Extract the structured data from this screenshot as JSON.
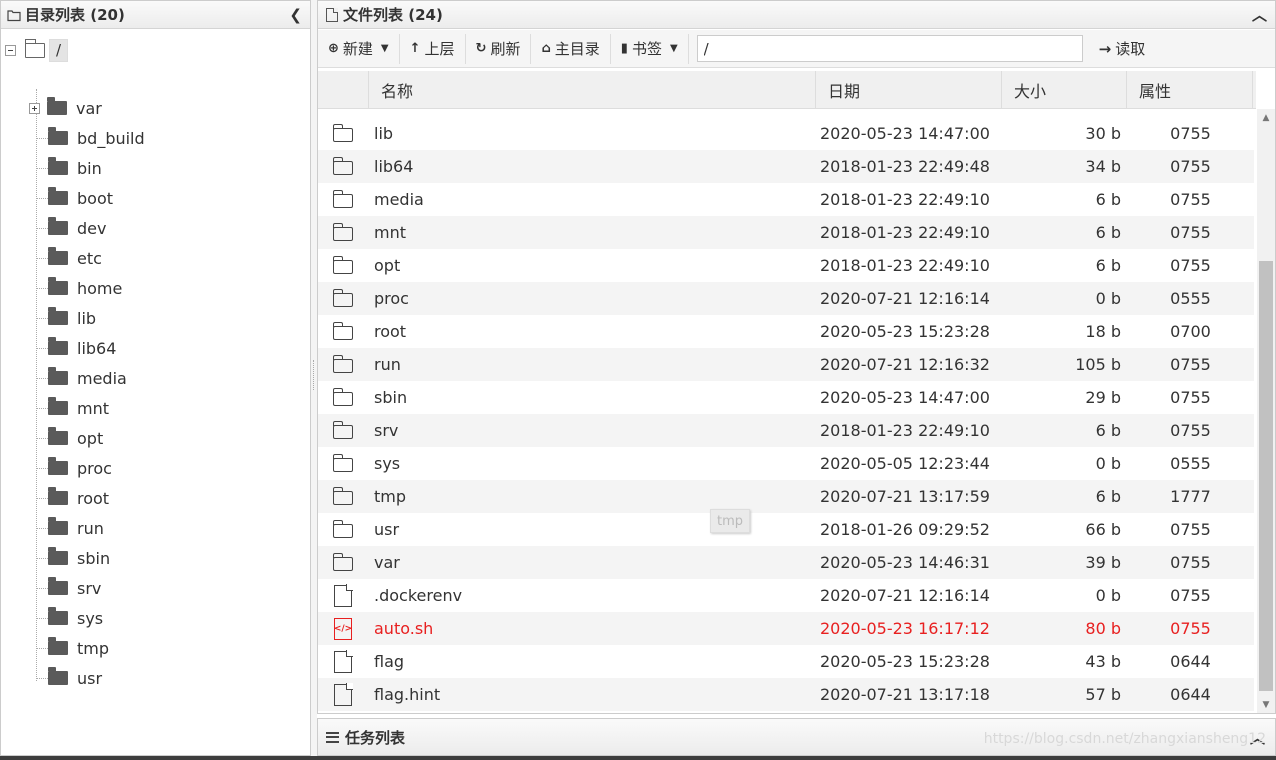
{
  "left_panel": {
    "title": "目录列表 (20)",
    "root_label": "/",
    "items": [
      {
        "label": "var",
        "expandable": true
      },
      {
        "label": "bd_build"
      },
      {
        "label": "bin"
      },
      {
        "label": "boot"
      },
      {
        "label": "dev"
      },
      {
        "label": "etc"
      },
      {
        "label": "home"
      },
      {
        "label": "lib"
      },
      {
        "label": "lib64"
      },
      {
        "label": "media"
      },
      {
        "label": "mnt"
      },
      {
        "label": "opt"
      },
      {
        "label": "proc"
      },
      {
        "label": "root"
      },
      {
        "label": "run"
      },
      {
        "label": "sbin"
      },
      {
        "label": "srv"
      },
      {
        "label": "sys"
      },
      {
        "label": "tmp"
      },
      {
        "label": "usr"
      }
    ]
  },
  "right_panel": {
    "title": "文件列表 (24)",
    "toolbar": {
      "new_label": "新建",
      "up_label": "上层",
      "refresh_label": "刷新",
      "home_label": "主目录",
      "bookmark_label": "书签",
      "path_value": "/",
      "read_label": "读取"
    },
    "columns": [
      "名称",
      "日期",
      "大小",
      "属性"
    ],
    "files": [
      {
        "name": "lib",
        "date": "2020-05-23 14:47:00",
        "size": "30 b",
        "attr": "0755",
        "type": "folder"
      },
      {
        "name": "lib64",
        "date": "2018-01-23 22:49:48",
        "size": "34 b",
        "attr": "0755",
        "type": "folder"
      },
      {
        "name": "media",
        "date": "2018-01-23 22:49:10",
        "size": "6 b",
        "attr": "0755",
        "type": "folder"
      },
      {
        "name": "mnt",
        "date": "2018-01-23 22:49:10",
        "size": "6 b",
        "attr": "0755",
        "type": "folder"
      },
      {
        "name": "opt",
        "date": "2018-01-23 22:49:10",
        "size": "6 b",
        "attr": "0755",
        "type": "folder"
      },
      {
        "name": "proc",
        "date": "2020-07-21 12:16:14",
        "size": "0 b",
        "attr": "0555",
        "type": "folder"
      },
      {
        "name": "root",
        "date": "2020-05-23 15:23:28",
        "size": "18 b",
        "attr": "0700",
        "type": "folder"
      },
      {
        "name": "run",
        "date": "2020-07-21 12:16:32",
        "size": "105 b",
        "attr": "0755",
        "type": "folder"
      },
      {
        "name": "sbin",
        "date": "2020-05-23 14:47:00",
        "size": "29 b",
        "attr": "0755",
        "type": "folder"
      },
      {
        "name": "srv",
        "date": "2018-01-23 22:49:10",
        "size": "6 b",
        "attr": "0755",
        "type": "folder"
      },
      {
        "name": "sys",
        "date": "2020-05-05 12:23:44",
        "size": "0 b",
        "attr": "0555",
        "type": "folder"
      },
      {
        "name": "tmp",
        "date": "2020-07-21 13:17:59",
        "size": "6 b",
        "attr": "1777",
        "type": "folder"
      },
      {
        "name": "usr",
        "date": "2018-01-26 09:29:52",
        "size": "66 b",
        "attr": "0755",
        "type": "folder"
      },
      {
        "name": "var",
        "date": "2020-05-23 14:46:31",
        "size": "39 b",
        "attr": "0755",
        "type": "folder"
      },
      {
        "name": ".dockerenv",
        "date": "2020-07-21 12:16:14",
        "size": "0 b",
        "attr": "0755",
        "type": "file"
      },
      {
        "name": "auto.sh",
        "date": "2020-05-23 16:17:12",
        "size": "80 b",
        "attr": "0755",
        "type": "script",
        "highlight": true
      },
      {
        "name": "flag",
        "date": "2020-05-23 15:23:28",
        "size": "43 b",
        "attr": "0644",
        "type": "file"
      },
      {
        "name": "flag.hint",
        "date": "2020-07-21 13:17:18",
        "size": "57 b",
        "attr": "0644",
        "type": "file"
      }
    ],
    "tooltip": "tmp"
  },
  "task_panel": {
    "title": "任务列表"
  },
  "watermark": "https://blog.csdn.net/zhangxiansheng12",
  "colors": {
    "highlight_red": "#e82020",
    "header_bg": "#ececec"
  }
}
